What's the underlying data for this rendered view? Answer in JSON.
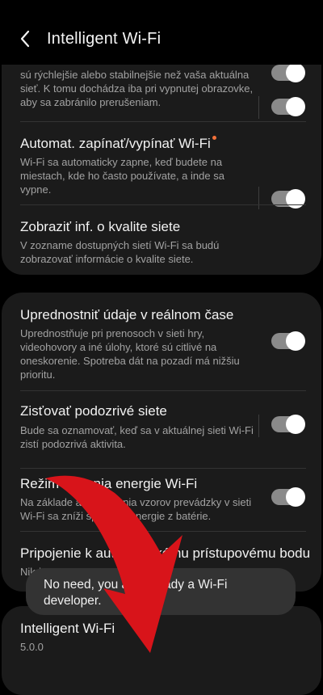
{
  "header": {
    "title": "Intelligent Wi-Fi",
    "back_icon": "chevron-left-icon"
  },
  "items": [
    {
      "desc": "sú rýchlejšie alebo stabilnejšie než vaša aktuálna sieť. K tomu dochádza iba pri vypnutej obrazovke, aby sa zabránilo prerušeniam.",
      "toggle_on": true
    },
    {
      "title": "Automat. zapínať/vypínať Wi-Fi",
      "desc": "Wi-Fi sa automaticky zapne, keď budete na miestach, kde ho často používate, a inde sa vypne.",
      "toggle_on": true,
      "badge_color": "#f3713a"
    },
    {
      "title": "Zobraziť inf. o kvalite siete",
      "desc": "V zozname dostupných sietí Wi-Fi sa budú zobrazovať informácie o kvalite siete.",
      "toggle_on": true
    },
    {
      "title": "Uprednostniť údaje v reálnom čase",
      "desc": "Uprednostňuje pri prenosoch v sieti hry, videohovory a iné úlohy, ktoré sú citlivé na oneskorenie. Spotreba dát na pozadí má nižšiu prioritu.",
      "toggle_on": true
    },
    {
      "title": "Zisťovať podozrivé siete",
      "desc": "Bude sa oznamovať, keď sa v aktuálnej sieti Wi-Fi zistí podozrivá aktivita.",
      "toggle_on": true
    },
    {
      "title": "Režim šetrenia energie Wi-Fi",
      "desc": "Na základe analyzovania vzorov prevádzky v sieti Wi-Fi sa zníži spotreba energie z batérie.",
      "toggle_on": true
    },
    {
      "title": "Pripojenie k automatickému prístupovému bodu",
      "desc": "Nikdy"
    }
  ],
  "about": {
    "title": "Intelligent Wi-Fi",
    "version": "5.0.0"
  },
  "toast": {
    "text": "No need, you are already a Wi-Fi developer."
  },
  "colors": {
    "background": "#000000",
    "card": "#1b1b1b",
    "toggle_track": "#8a8a8a",
    "arrow": "#d8141a",
    "badge": "#f3713a"
  }
}
